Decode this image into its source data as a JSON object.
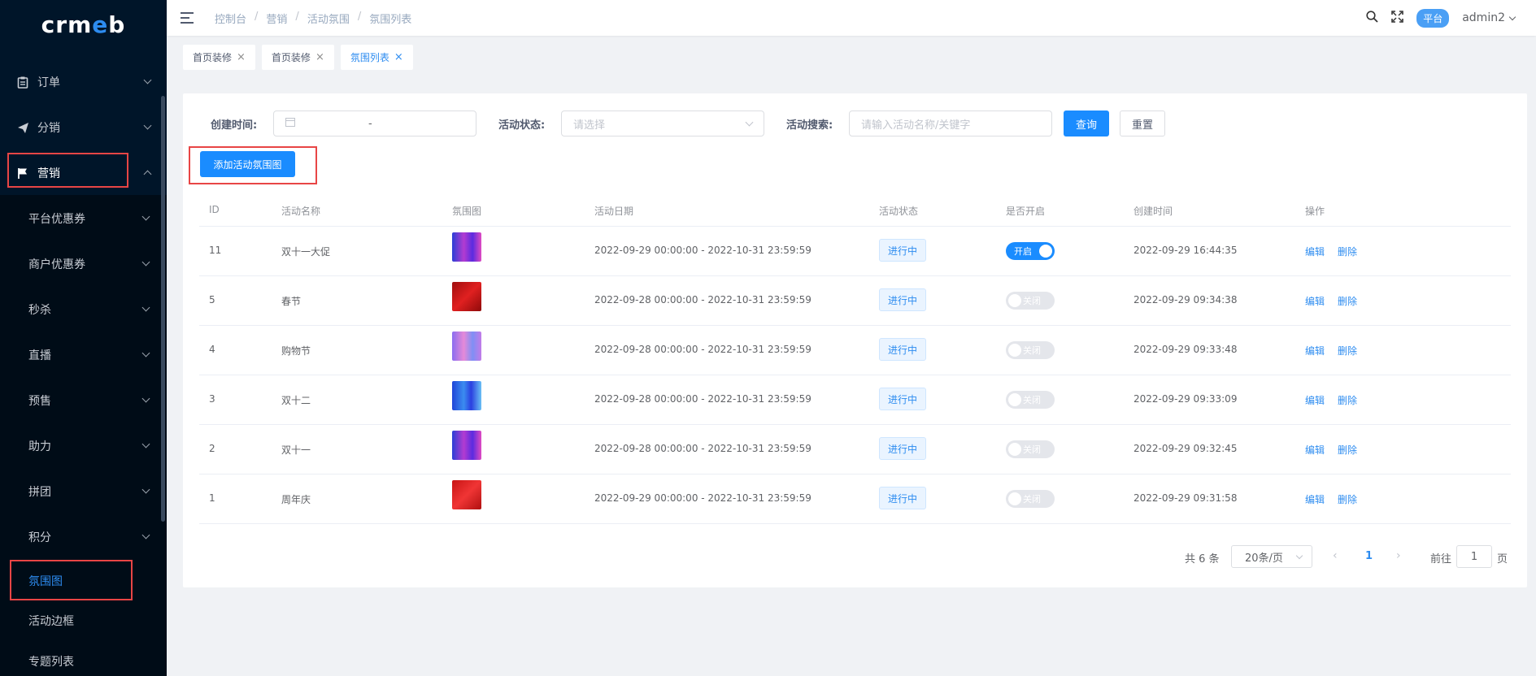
{
  "app": {
    "logo_text": "crmeb"
  },
  "sidebar": {
    "items": [
      {
        "label": "订单",
        "icon": "clipboard-icon"
      },
      {
        "label": "分销",
        "icon": "send-icon"
      },
      {
        "label": "营销",
        "icon": "flag-icon"
      }
    ],
    "sub_items": [
      {
        "label": "平台优惠券"
      },
      {
        "label": "商户优惠券"
      },
      {
        "label": "秒杀"
      },
      {
        "label": "直播"
      },
      {
        "label": "预售"
      },
      {
        "label": "助力"
      },
      {
        "label": "拼团"
      },
      {
        "label": "积分"
      },
      {
        "label": "氛围图"
      },
      {
        "label": "活动边框"
      },
      {
        "label": "专题列表"
      }
    ]
  },
  "header": {
    "breadcrumb": [
      "控制台",
      "营销",
      "活动氛围",
      "氛围列表"
    ],
    "platform_badge": "平台",
    "username": "admin2"
  },
  "tabs": [
    {
      "label": "首页装修"
    },
    {
      "label": "首页装修"
    },
    {
      "label": "氛围列表"
    }
  ],
  "filters": {
    "date_label": "创建时间:",
    "date_separator": "-",
    "status_label": "活动状态:",
    "status_placeholder": "请选择",
    "search_label": "活动搜索:",
    "search_placeholder": "请输入活动名称/关键字",
    "query_button": "查询",
    "reset_button": "重置"
  },
  "add_button": "添加活动氛围图",
  "table": {
    "columns": [
      "ID",
      "活动名称",
      "氛围图",
      "活动日期",
      "活动状态",
      "是否开启",
      "创建时间",
      "操作"
    ],
    "rows": [
      {
        "id": "11",
        "name": "双十一大促",
        "date": "2022-09-29 00:00:00 - 2022-10-31 23:59:59",
        "status": "进行中",
        "enabled": "开启",
        "created": "2022-09-29 16:44:35",
        "edit": "编辑",
        "delete": "删除"
      },
      {
        "id": "5",
        "name": "春节",
        "date": "2022-09-28 00:00:00 - 2022-10-31 23:59:59",
        "status": "进行中",
        "enabled": "关闭",
        "created": "2022-09-29 09:34:38",
        "edit": "编辑",
        "delete": "删除"
      },
      {
        "id": "4",
        "name": "购物节",
        "date": "2022-09-28 00:00:00 - 2022-10-31 23:59:59",
        "status": "进行中",
        "enabled": "关闭",
        "created": "2022-09-29 09:33:48",
        "edit": "编辑",
        "delete": "删除"
      },
      {
        "id": "3",
        "name": "双十二",
        "date": "2022-09-28 00:00:00 - 2022-10-31 23:59:59",
        "status": "进行中",
        "enabled": "关闭",
        "created": "2022-09-29 09:33:09",
        "edit": "编辑",
        "delete": "删除"
      },
      {
        "id": "2",
        "name": "双十一",
        "date": "2022-09-28 00:00:00 - 2022-10-31 23:59:59",
        "status": "进行中",
        "enabled": "关闭",
        "created": "2022-09-29 09:32:45",
        "edit": "编辑",
        "delete": "删除"
      },
      {
        "id": "1",
        "name": "周年庆",
        "date": "2022-09-29 00:00:00 - 2022-10-31 23:59:59",
        "status": "进行中",
        "enabled": "关闭",
        "created": "2022-09-29 09:31:58",
        "edit": "编辑",
        "delete": "删除"
      }
    ]
  },
  "pagination": {
    "total": "共 6 条",
    "page_size": "20条/页",
    "current_page": "1",
    "goto_label": "前往",
    "goto_value": "1",
    "page_suffix": "页"
  },
  "colors": {
    "primary": "#1a8cff",
    "sidebar_bg": "#001529",
    "highlight_border": "#e84545"
  }
}
